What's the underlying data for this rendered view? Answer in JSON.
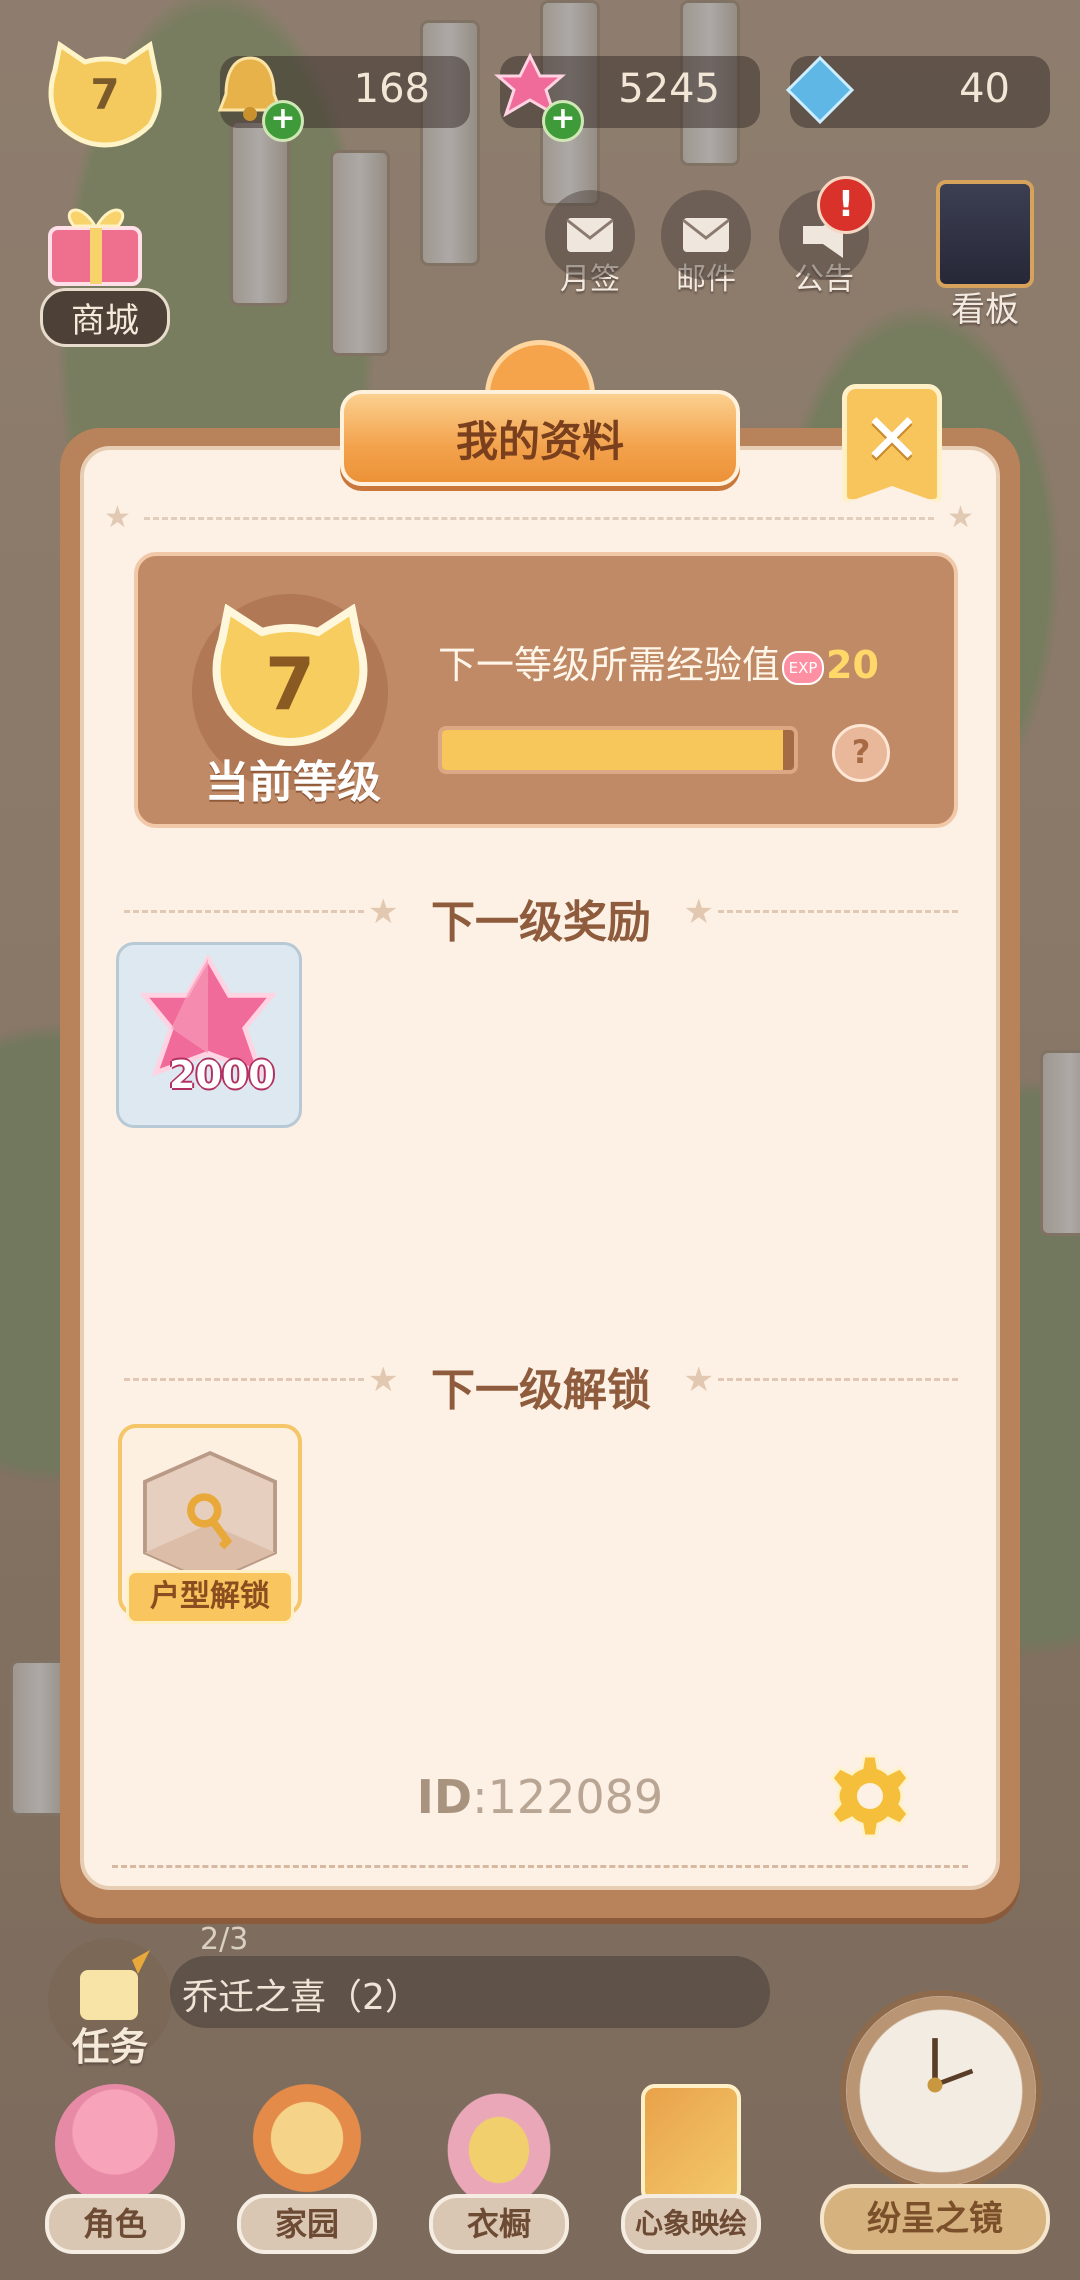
{
  "hud": {
    "level": "7",
    "bells": "168",
    "gems": "5245",
    "crystals": "40",
    "shop_label": "商城",
    "buttons": [
      {
        "label": "月签"
      },
      {
        "label": "邮件"
      },
      {
        "label": "公告",
        "badge": "!"
      }
    ],
    "kanban_label": "看板"
  },
  "dialog": {
    "title": "我的资料",
    "close": "✕",
    "current_level": "7",
    "current_level_label": "当前等级",
    "next_exp_text": "下一等级所需经验值",
    "exp_icon": "EXP",
    "next_exp_value": "20",
    "exp_progress_fraction": 0.97,
    "help": "?",
    "reward_section": "下一级奖励",
    "reward_amount": "2000",
    "unlock_section": "下一级解锁",
    "unlock_label": "户型解锁",
    "id_label": "ID",
    "id_value": ":122089"
  },
  "quest": {
    "label": "任务",
    "count": "2/3",
    "name": "乔迁之喜（2）"
  },
  "nav": [
    {
      "label": "角色"
    },
    {
      "label": "家园"
    },
    {
      "label": "衣橱"
    },
    {
      "label": "心象映绘"
    }
  ],
  "mirror_label": "纷呈之镜",
  "colors": {
    "accent_orange": "#f3a24c",
    "panel_bg": "#fdf0e4",
    "card_brown": "#c08a66",
    "progress_fill": "#f7c75c"
  }
}
